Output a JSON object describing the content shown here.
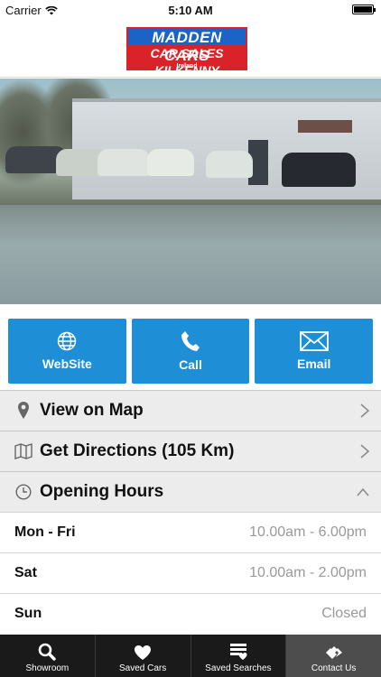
{
  "status": {
    "carrier": "Carrier",
    "time": "5:10 AM"
  },
  "header": {
    "logo_top": "MADDEN CARS",
    "logo_mid": "CAR SALES KILKENNY",
    "logo_bot": "Ireland"
  },
  "actions": [
    {
      "label": "WebSite",
      "icon": "globe-icon"
    },
    {
      "label": "Call",
      "icon": "phone-icon"
    },
    {
      "label": "Email",
      "icon": "envelope-icon"
    }
  ],
  "list": {
    "map": "View on Map",
    "directions": "Get Directions (105 Km)",
    "hours_title": "Opening Hours"
  },
  "hours": [
    {
      "day": "Mon - Fri",
      "time": "10.00am - 6.00pm"
    },
    {
      "day": "Sat",
      "time": "10.00am - 2.00pm"
    },
    {
      "day": "Sun",
      "time": "Closed"
    }
  ],
  "tabs": [
    {
      "label": "Showroom",
      "icon": "magnifier-icon"
    },
    {
      "label": "Saved Cars",
      "icon": "heart-icon"
    },
    {
      "label": "Saved Searches",
      "icon": "saved-list-icon"
    },
    {
      "label": "Contact Us",
      "icon": "handshake-icon"
    }
  ],
  "colors": {
    "accent": "#1e8fd6",
    "tabbar": "#1a1a1a",
    "logo_blue": "#1b63c7",
    "logo_red": "#d9222a"
  }
}
